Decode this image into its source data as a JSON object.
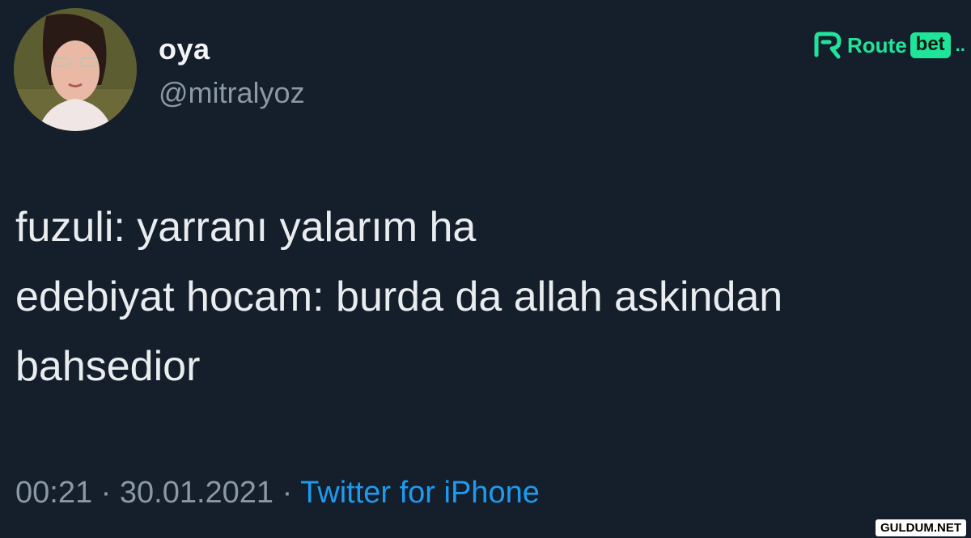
{
  "author": {
    "display_name": "oya",
    "handle": "@mitralyoz"
  },
  "tweet": {
    "lines": [
      "fuzuli: yarranı yalarım ha",
      "edebiyat hocam: burda da allah askindan",
      "bahsedior"
    ]
  },
  "meta": {
    "time": "00:21",
    "separator": "·",
    "date": "30.01.2021",
    "source": "Twitter for iPhone"
  },
  "logo": {
    "word": "Route",
    "badge": "bet",
    "dots": ".."
  },
  "watermark": "GULDUM.NET",
  "colors": {
    "background": "#151e2b",
    "text": "#e9edef",
    "muted": "#8b98a5",
    "link": "#1d9bf0",
    "brand": "#1fe59a"
  }
}
